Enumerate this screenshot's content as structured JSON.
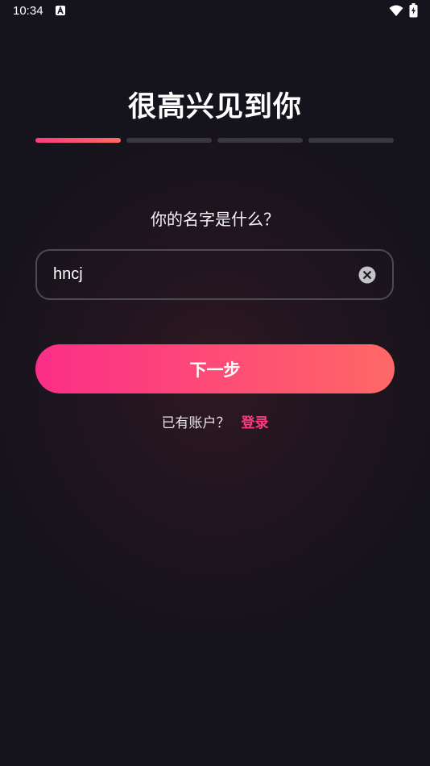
{
  "status_bar": {
    "time": "10:34"
  },
  "icons": {
    "status_a": "text-a-icon",
    "wifi": "wifi-icon",
    "battery": "battery-charging-icon",
    "clear": "clear-circle-icon"
  },
  "colors": {
    "background": "#15131b",
    "accent_start": "#fc2e87",
    "accent_end": "#fe6866",
    "progress_inactive": "#393841",
    "login_link": "#fc3b80"
  },
  "header": {
    "title": "很高兴见到你"
  },
  "progress": {
    "total_steps": 4,
    "current_step": 1
  },
  "form": {
    "question": "你的名字是什么？",
    "name_value": "hncj"
  },
  "actions": {
    "next_label": "下一步",
    "login_prompt": "已有账户？",
    "login_link": "登录"
  }
}
